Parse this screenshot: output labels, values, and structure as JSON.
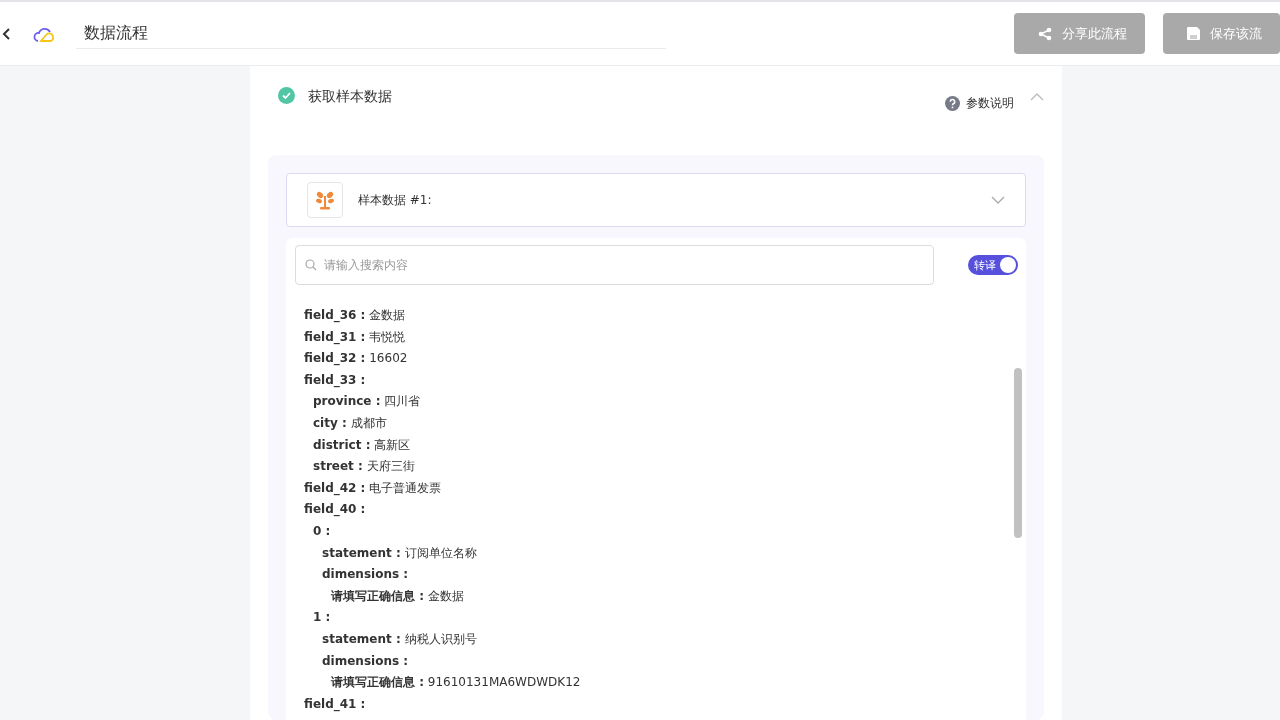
{
  "header": {
    "title": "数据流程",
    "buttons": [
      {
        "label": "分享此流程",
        "kind": "share",
        "disabled": true
      },
      {
        "label": "保存该流",
        "kind": "save",
        "disabled": true
      }
    ]
  },
  "step": {
    "title": "获取样本数据",
    "done": true,
    "help": "参数说明",
    "expanded": true
  },
  "sample": {
    "title": "样本数据 #1:",
    "expanded": false
  },
  "search": {
    "placeholder": "请输入搜索内容"
  },
  "toggle": {
    "label": "转译",
    "on": true
  },
  "tree": [
    {
      "key": "field_36 :",
      "value": "金数据"
    },
    {
      "key": "field_31 :",
      "value": "韦悦悦"
    },
    {
      "key": "field_32 :",
      "value": "16602"
    },
    {
      "key": "field_33 :",
      "children": [
        {
          "key": "province :",
          "value": "四川省"
        },
        {
          "key": "city :",
          "value": "成都市"
        },
        {
          "key": "district :",
          "value": "高新区"
        },
        {
          "key": "street :",
          "value": "天府三街"
        }
      ]
    },
    {
      "key": "field_42 :",
      "value": "电子普通发票"
    },
    {
      "key": "field_40 :",
      "children": [
        {
          "key": "0 :",
          "children": [
            {
              "key": "statement :",
              "value": "订阅单位名称"
            },
            {
              "key": "dimensions :",
              "children": [
                {
                  "key": "请填写正确信息 :",
                  "value": "金数据"
                }
              ]
            }
          ]
        },
        {
          "key": "1 :",
          "children": [
            {
              "key": "statement :",
              "value": "纳税人识别号"
            },
            {
              "key": "dimensions :",
              "children": [
                {
                  "key": "请填写正确信息 :",
                  "value": "91610131MA6WDWDK12"
                }
              ]
            }
          ]
        }
      ]
    },
    {
      "key": "field_41 :"
    }
  ]
}
